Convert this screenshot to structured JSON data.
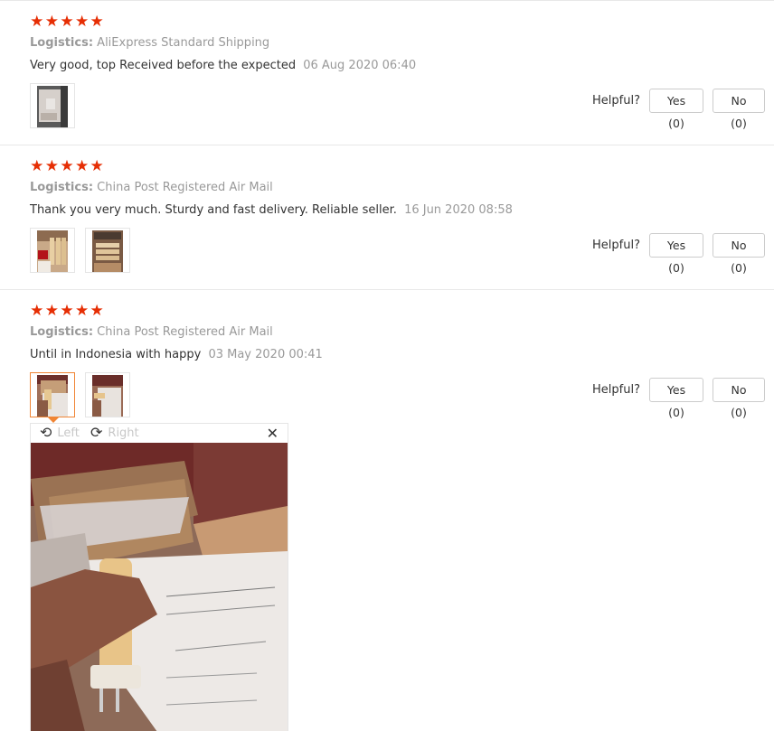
{
  "reviews": [
    {
      "rating_stars": 5,
      "logistics_label": "Logistics:",
      "logistics_value": "AliExpress Standard Shipping",
      "comment": "Very good, top Received before the expected",
      "date": "06 Aug 2020 06:40",
      "helpful_label": "Helpful?",
      "yes_label": "Yes (0)",
      "no_label": "No (0)"
    },
    {
      "rating_stars": 5,
      "logistics_label": "Logistics:",
      "logistics_value": "China Post Registered Air Mail",
      "comment": "Thank you very much. Sturdy and fast delivery. Reliable seller.",
      "date": "16 Jun 2020 08:58",
      "helpful_label": "Helpful?",
      "yes_label": "Yes (0)",
      "no_label": "No (0)"
    },
    {
      "rating_stars": 5,
      "logistics_label": "Logistics:",
      "logistics_value": "China Post Registered Air Mail",
      "comment": "Until in Indonesia with happy",
      "date": "03 May 2020 00:41",
      "helpful_label": "Helpful?",
      "yes_label": "Yes (0)",
      "no_label": "No (0)"
    }
  ],
  "viewer": {
    "rotate_left_label": "Left",
    "rotate_right_label": "Right",
    "close_icon": "close-icon"
  },
  "colors": {
    "star": "#e62e04",
    "active_thumb_border": "#f08535",
    "muted_text": "#999999",
    "divider": "#e8e8e8"
  }
}
